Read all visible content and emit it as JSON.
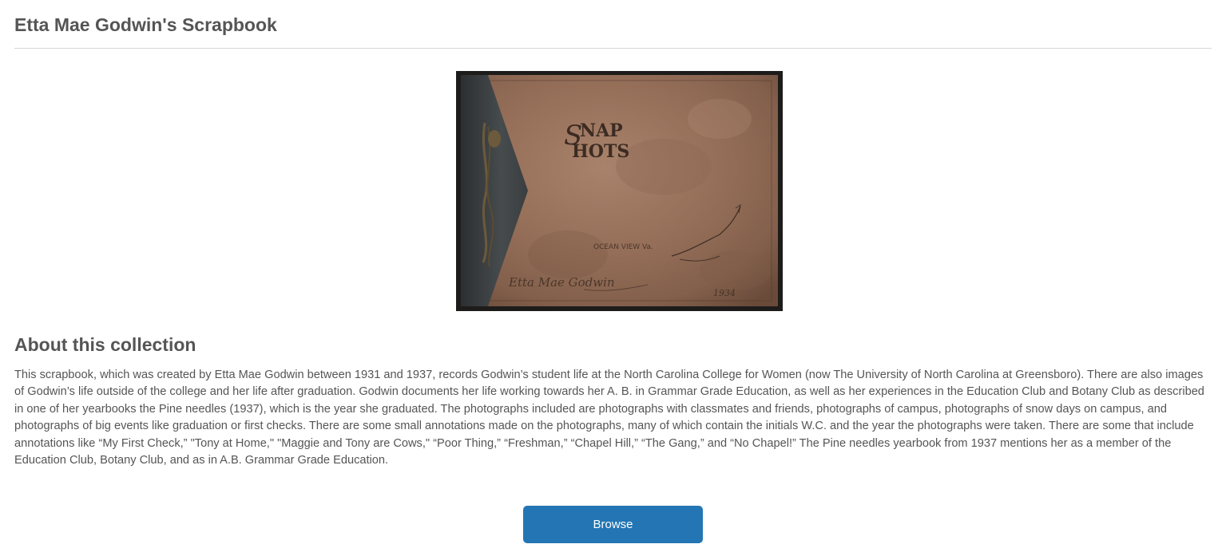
{
  "page": {
    "title": "Etta Mae Godwin's Scrapbook"
  },
  "cover_image": {
    "title_text": "SNAP SHOTS",
    "caption_text": "OCEAN VIEW Va.",
    "signature": "Etta Mae Godwin",
    "year": "1934"
  },
  "about": {
    "heading": "About this collection",
    "body": "This scrapbook, which was created by Etta Mae Godwin between 1931 and 1937, records Godwin’s student life at the North Carolina College for Women (now The University of North Carolina at Greensboro). There are also images of Godwin’s life outside of the college and her life after graduation. Godwin documents her life working towards her A. B. in Grammar Grade Education, as well as her experiences in the Education Club and Botany Club as described in one of her yearbooks the Pine needles (1937), which is the year she graduated. The photographs included are photographs with classmates and friends, photographs of campus, photographs of snow days on campus, and photographs of big events like graduation or first checks. There are some small annotations made on the photographs, many of which contain the initials W.C. and the year the photographs were taken. There are some that include annotations like “My First Check,” \"Tony at Home,\" \"Maggie and Tony are Cows,\" “Poor Thing,” “Freshman,” “Chapel Hill,” “The Gang,” and “No Chapel!” The Pine needles yearbook from 1937 mentions her as a member of the Education Club, Botany Club, and as in A.B. Grammar Grade Education."
  },
  "actions": {
    "browse_label": "Browse"
  },
  "colors": {
    "text": "#555555",
    "divider": "#d6d6d6",
    "button": "#2376b3",
    "button_text": "#ffffff"
  }
}
